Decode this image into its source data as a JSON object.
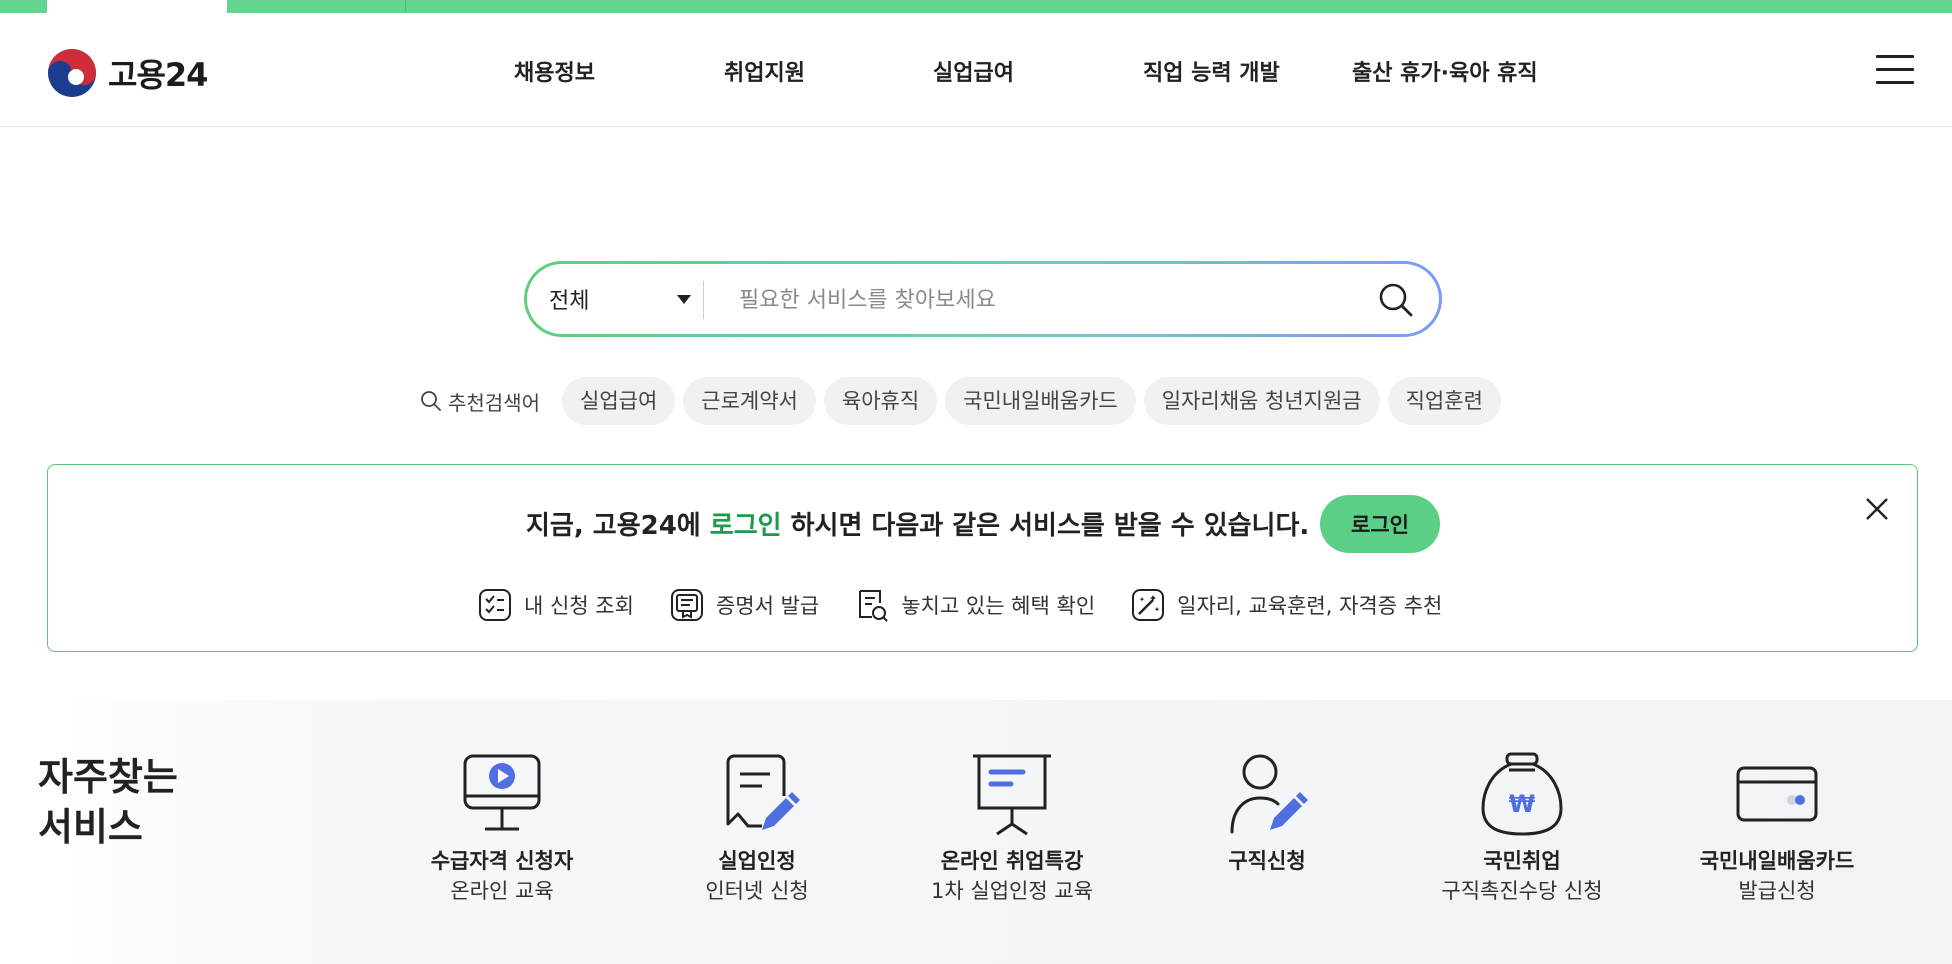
{
  "brand": {
    "name": "고용24"
  },
  "nav": {
    "items": [
      {
        "label": "채용정보"
      },
      {
        "label": "취업지원"
      },
      {
        "label": "실업급여"
      },
      {
        "label": "직업 능력 개발"
      },
      {
        "label": "출산 휴가·육아 휴직"
      }
    ],
    "menu_icon": "hamburger-icon"
  },
  "search": {
    "category": "전체",
    "placeholder": "필요한 서비스를 찾아보세요",
    "value": "",
    "button_icon": "search-icon"
  },
  "recommended": {
    "label": "추천검색어",
    "keywords": [
      "실업급여",
      "근로계약서",
      "육아휴직",
      "국민내일배움카드",
      "일자리채움 청년지원금",
      "직업훈련"
    ]
  },
  "login_banner": {
    "msg_before": "지금, 고용24에",
    "msg_highlight": "로그인",
    "msg_after": "하시면 다음과 같은 서비스를 받을 수 있습니다.",
    "button": "로그인",
    "benefits": [
      {
        "icon": "checklist-icon",
        "label": "내 신청 조회"
      },
      {
        "icon": "certificate-icon",
        "label": "증명서 발급"
      },
      {
        "icon": "document-search-icon",
        "label": "놓치고 있는 혜택 확인"
      },
      {
        "icon": "magic-wand-icon",
        "label": "일자리, 교육훈련, 자격증 추천"
      }
    ]
  },
  "frequent": {
    "title_line1": "자주찾는",
    "title_line2": "서비스",
    "items": [
      {
        "icon": "monitor-play-icon",
        "line1": "수급자격 신청자",
        "line2": "온라인 교육"
      },
      {
        "icon": "document-pen-icon",
        "line1": "실업인정",
        "line2": "인터넷 신청"
      },
      {
        "icon": "presentation-board-icon",
        "line1": "온라인 취업특강",
        "line2": "1차 실업인정 교육"
      },
      {
        "icon": "person-pen-icon",
        "line1": "구직신청",
        "line2": ""
      },
      {
        "icon": "money-bag-icon",
        "line1": "국민취업",
        "line2": "구직촉진수당 신청"
      },
      {
        "icon": "card-icon",
        "line1": "국민내일배움카드",
        "line2": "발급신청"
      }
    ]
  },
  "colors": {
    "accent_green": "#66d38e",
    "highlight_green": "#1f9a4b",
    "icon_blue": "#4f6fe0"
  }
}
